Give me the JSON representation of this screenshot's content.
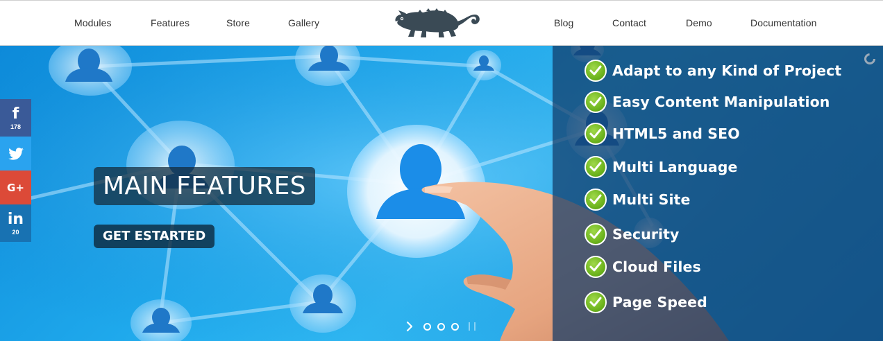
{
  "nav": {
    "left": [
      "Modules",
      "Features",
      "Store",
      "Gallery"
    ],
    "right": [
      "Blog",
      "Contact",
      "Demo",
      "Documentation"
    ],
    "logo_icon": "chameleon-logo"
  },
  "hero": {
    "title": "MAIN FEATURES",
    "cta": "GET ESTARTED",
    "features": [
      "Adapt to any Kind of Project",
      "Easy Content Manipulation",
      "HTML5 and SEO",
      "Multi Language",
      "Multi Site",
      "Security",
      "Cloud Files",
      "Page Speed"
    ],
    "slider": {
      "slides": 3,
      "next_icon": "chevron-right-icon",
      "pause_icon": "pause-icon"
    }
  },
  "social": {
    "facebook": {
      "icon": "facebook-icon",
      "glyph": "f",
      "count": "178",
      "color": "#3a5a98"
    },
    "twitter": {
      "icon": "twitter-icon",
      "color": "#2aa3ef"
    },
    "google_plus": {
      "icon": "google-plus-icon",
      "glyph": "G+",
      "color": "#dc4a38"
    },
    "linkedin": {
      "icon": "linkedin-icon",
      "glyph": "in",
      "count": "20",
      "color": "#1872b2"
    }
  },
  "colors": {
    "panel": "#103a68",
    "check_green": "#6eb51e",
    "hero_blue": "#1fa9ec"
  }
}
